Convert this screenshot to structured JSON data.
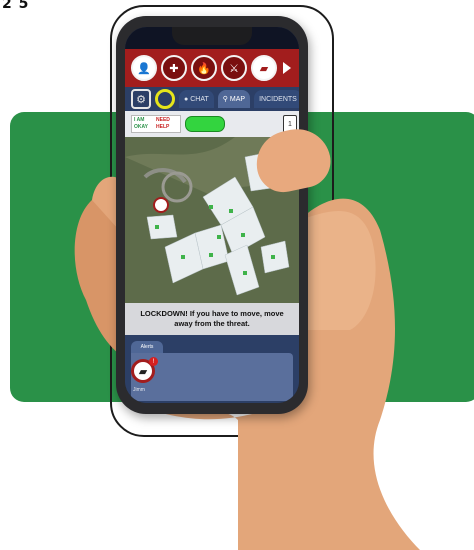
{
  "page_mark": "2 5",
  "app": {
    "toolbar": {
      "buttons": [
        {
          "name": "person-alert",
          "glyph": "👤"
        },
        {
          "name": "medical",
          "glyph": "✚"
        },
        {
          "name": "fire",
          "glyph": "🔥"
        },
        {
          "name": "weapon",
          "glyph": "⚔"
        },
        {
          "name": "gun",
          "glyph": "▰"
        }
      ]
    },
    "tabs": {
      "chat": "CHAT",
      "map": "MAP",
      "incidents": "INCIDENTS"
    },
    "lamp": {
      "ok_top": "I AM",
      "ok_bottom": "OKAY",
      "help_top": "NEED",
      "help_bottom": "HELP",
      "floor": "1"
    },
    "message": "LOCKDOWN! If you have to move, move away from the threat.",
    "alerts": {
      "tab_label": "Alerts",
      "item_label": "Jimm"
    },
    "colors": {
      "toolbar": "#a21d1d",
      "app_bg": "#2c3f66",
      "status_ok": "#33d43f",
      "panel": "#2a9148"
    }
  }
}
